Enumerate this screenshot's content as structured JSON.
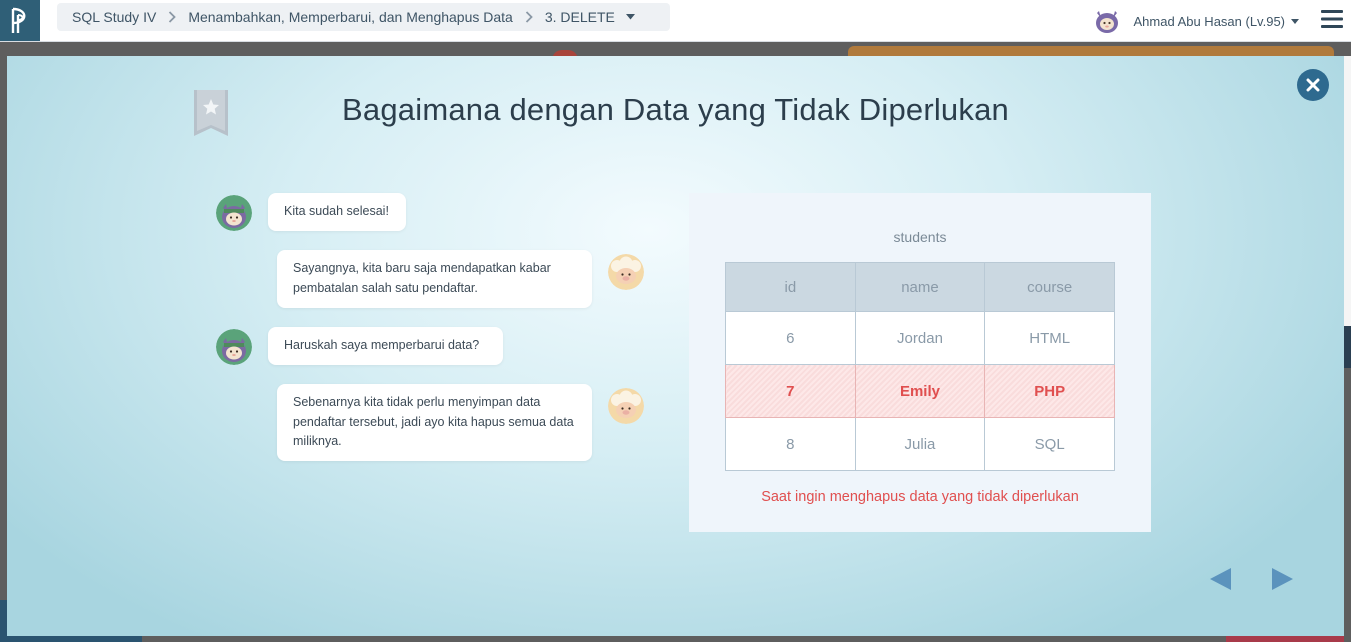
{
  "topbar": {
    "logo_icon": "progate-logo-icon",
    "breadcrumb": [
      {
        "label": "SQL Study IV"
      },
      {
        "label": "Menambahkan, Memperbarui, dan Menghapus Data"
      },
      {
        "label": "3. DELETE"
      }
    ],
    "user_name": "Ahmad Abu Hasan (Lv.95)",
    "menu_icon": "hamburger-menu-icon"
  },
  "modal": {
    "title": "Bagaimana dengan Data yang Tidak Diperlukan",
    "chat": [
      {
        "speaker": "ninja",
        "side": "left",
        "text": "Kita sudah selesai!"
      },
      {
        "speaker": "sheep",
        "side": "right",
        "text": "Sayangnya, kita baru saja mendapatkan kabar pembatalan salah satu pendaftar."
      },
      {
        "speaker": "ninja",
        "side": "left",
        "text": "Haruskah saya memperbarui data?"
      },
      {
        "speaker": "sheep",
        "side": "right",
        "text": "Sebenarnya kita tidak perlu menyimpan data pendaftar tersebut, jadi ayo kita hapus semua data miliknya."
      }
    ],
    "table": {
      "caption": "students",
      "headers": [
        "id",
        "name",
        "course"
      ],
      "rows": [
        {
          "id": "6",
          "name": "Jordan",
          "course": "HTML",
          "highlighted": false
        },
        {
          "id": "7",
          "name": "Emily",
          "course": "PHP",
          "highlighted": true
        },
        {
          "id": "8",
          "name": "Julia",
          "course": "SQL",
          "highlighted": false
        }
      ],
      "note": "Saat ingin menghapus data yang tidak diperlukan"
    }
  },
  "colors": {
    "accent_dark": "#2e6a8f",
    "highlight_red": "#e04f4f",
    "title_text": "#2c3e4c",
    "nav_arrow": "#5b93bd"
  }
}
